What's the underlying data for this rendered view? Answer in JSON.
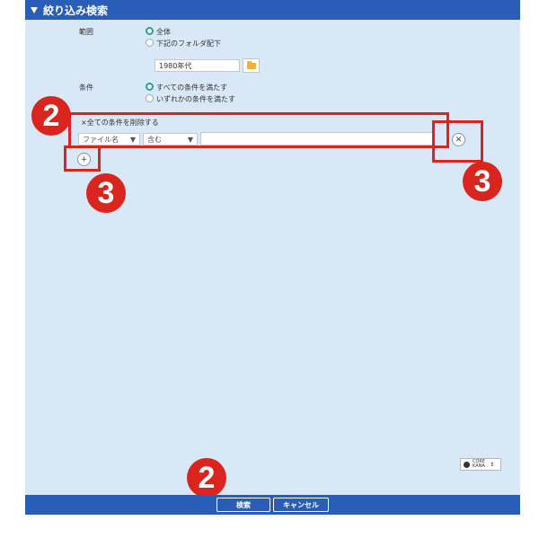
{
  "header": {
    "title": "絞り込み検索"
  },
  "scope": {
    "label": "範囲",
    "options": [
      "全体",
      "下記のフォルダ配下"
    ],
    "folder_value": "1980年代"
  },
  "condition": {
    "label": "条件",
    "options": [
      "すべての条件を満たす",
      "いずれかの条件を満たす"
    ],
    "delete_all": "×全ての条件を削除する",
    "field_select": "ファイル名",
    "operator_select": "含む",
    "value": ""
  },
  "annotations": {
    "two_top": "2",
    "three_left": "3",
    "three_right": "3",
    "two_bottom": "2"
  },
  "widget": {
    "line1": "CORE",
    "line2": "KANA"
  },
  "footer": {
    "search_label": "検索",
    "cancel_label": "キャンセル"
  },
  "colors": {
    "header": "#2a5db8",
    "panel": "#d9e8f7",
    "annotation": "#d9251d",
    "radio_selected": "#2aa198"
  }
}
